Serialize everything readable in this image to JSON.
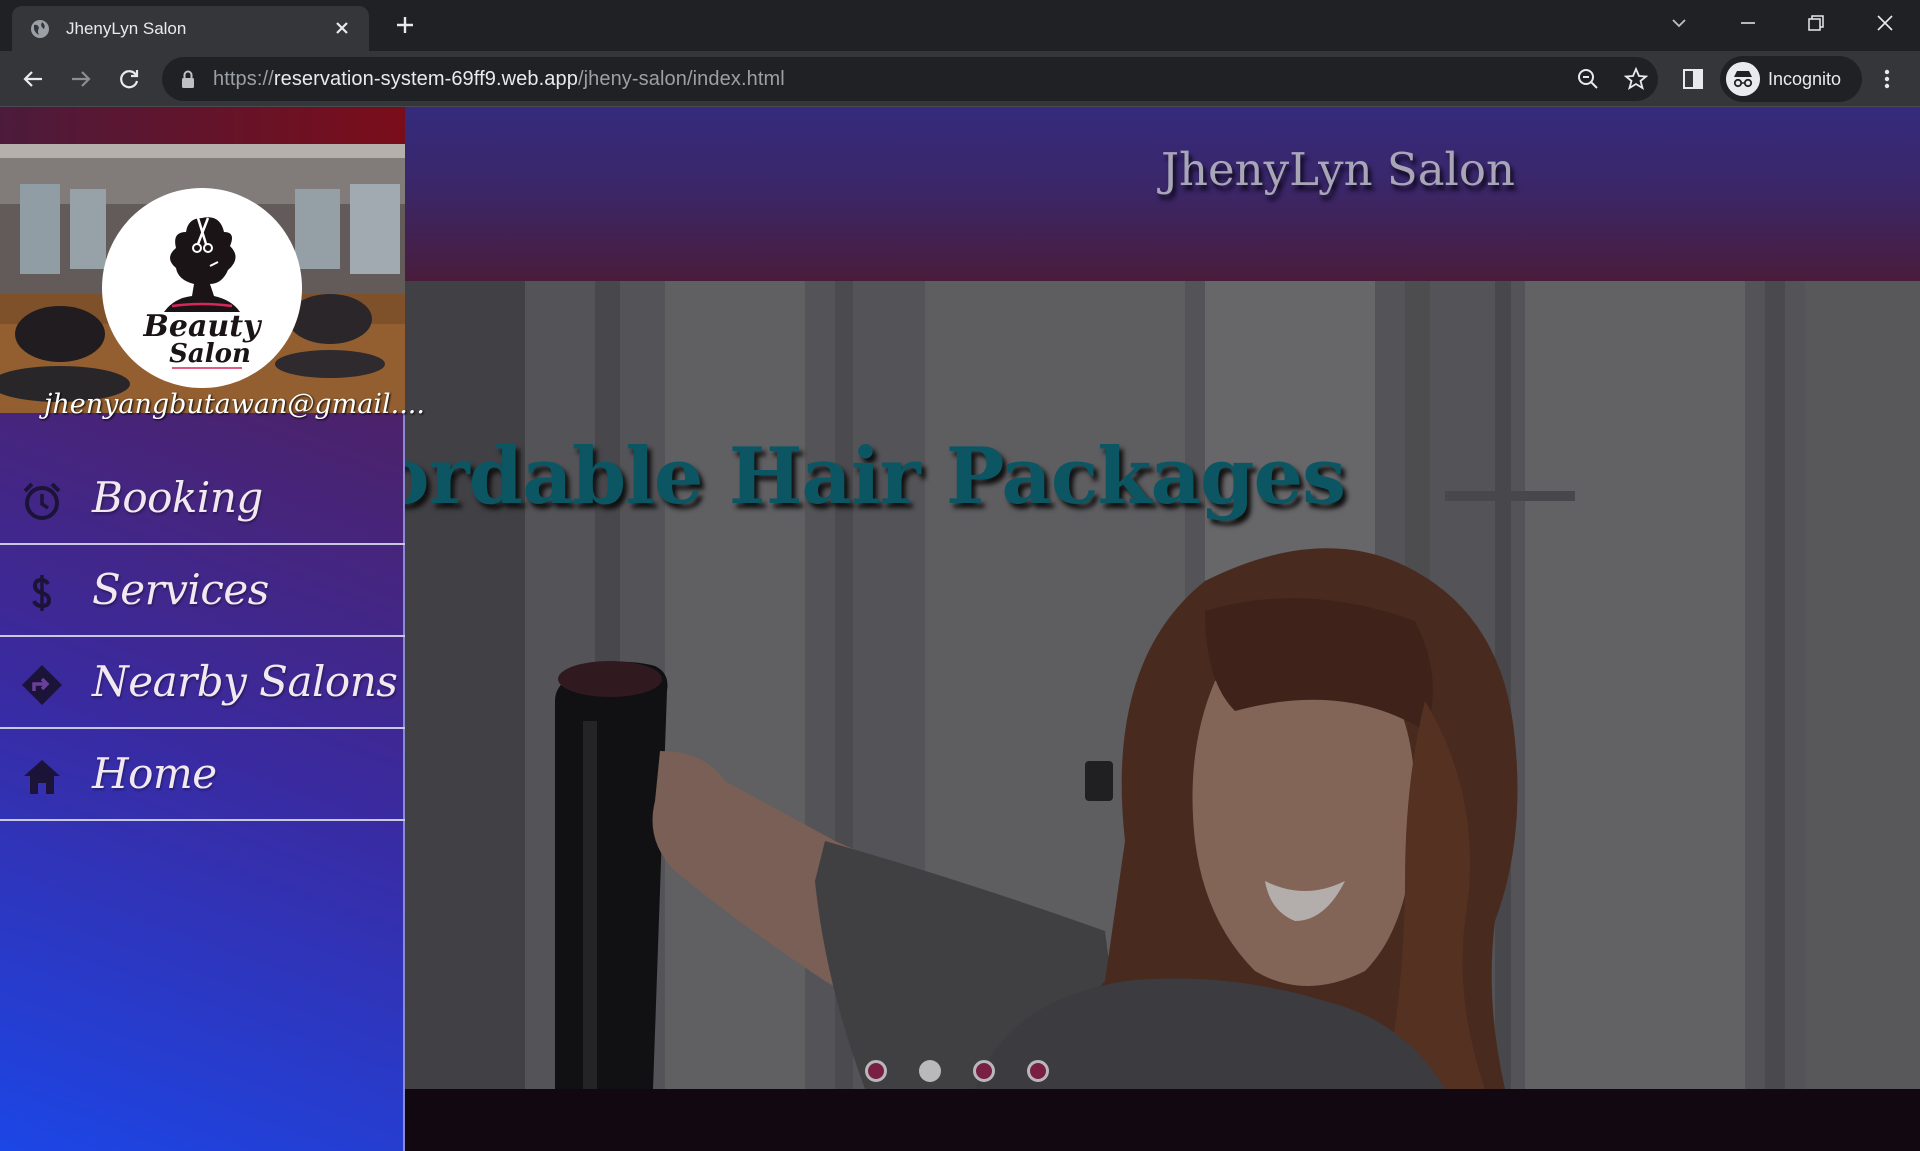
{
  "browser": {
    "tab_title": "JhenyLyn Salon",
    "url_prefix": "https://",
    "url_host": "reservation-system-69ff9.web.app",
    "url_path": "/jheny-salon/index.html",
    "profile_label": "Incognito"
  },
  "sidebar": {
    "logo_text": [
      "Beauty",
      "Salon"
    ],
    "email": "jhenyangbutawan@gmail....",
    "items": [
      {
        "label": "Booking",
        "icon": "alarm-clock-icon"
      },
      {
        "label": "Services",
        "icon": "dollar-icon"
      },
      {
        "label": "Nearby Salons",
        "icon": "directions-icon"
      },
      {
        "label": "Home",
        "icon": "home-icon"
      }
    ]
  },
  "header": {
    "title": "JhenyLyn Salon"
  },
  "carousel": {
    "caption": "Affordable Hair Packages",
    "visible_caption": "fordable Hair Packages",
    "slide_count": 4,
    "active_index": 1
  },
  "colors": {
    "sidebar_top": "#5c1845",
    "sidebar_bottom": "#1c46e6",
    "caption": "#0b5662",
    "dot_inactive": "#7a1f44",
    "dot_active": "#b9b9bb"
  }
}
